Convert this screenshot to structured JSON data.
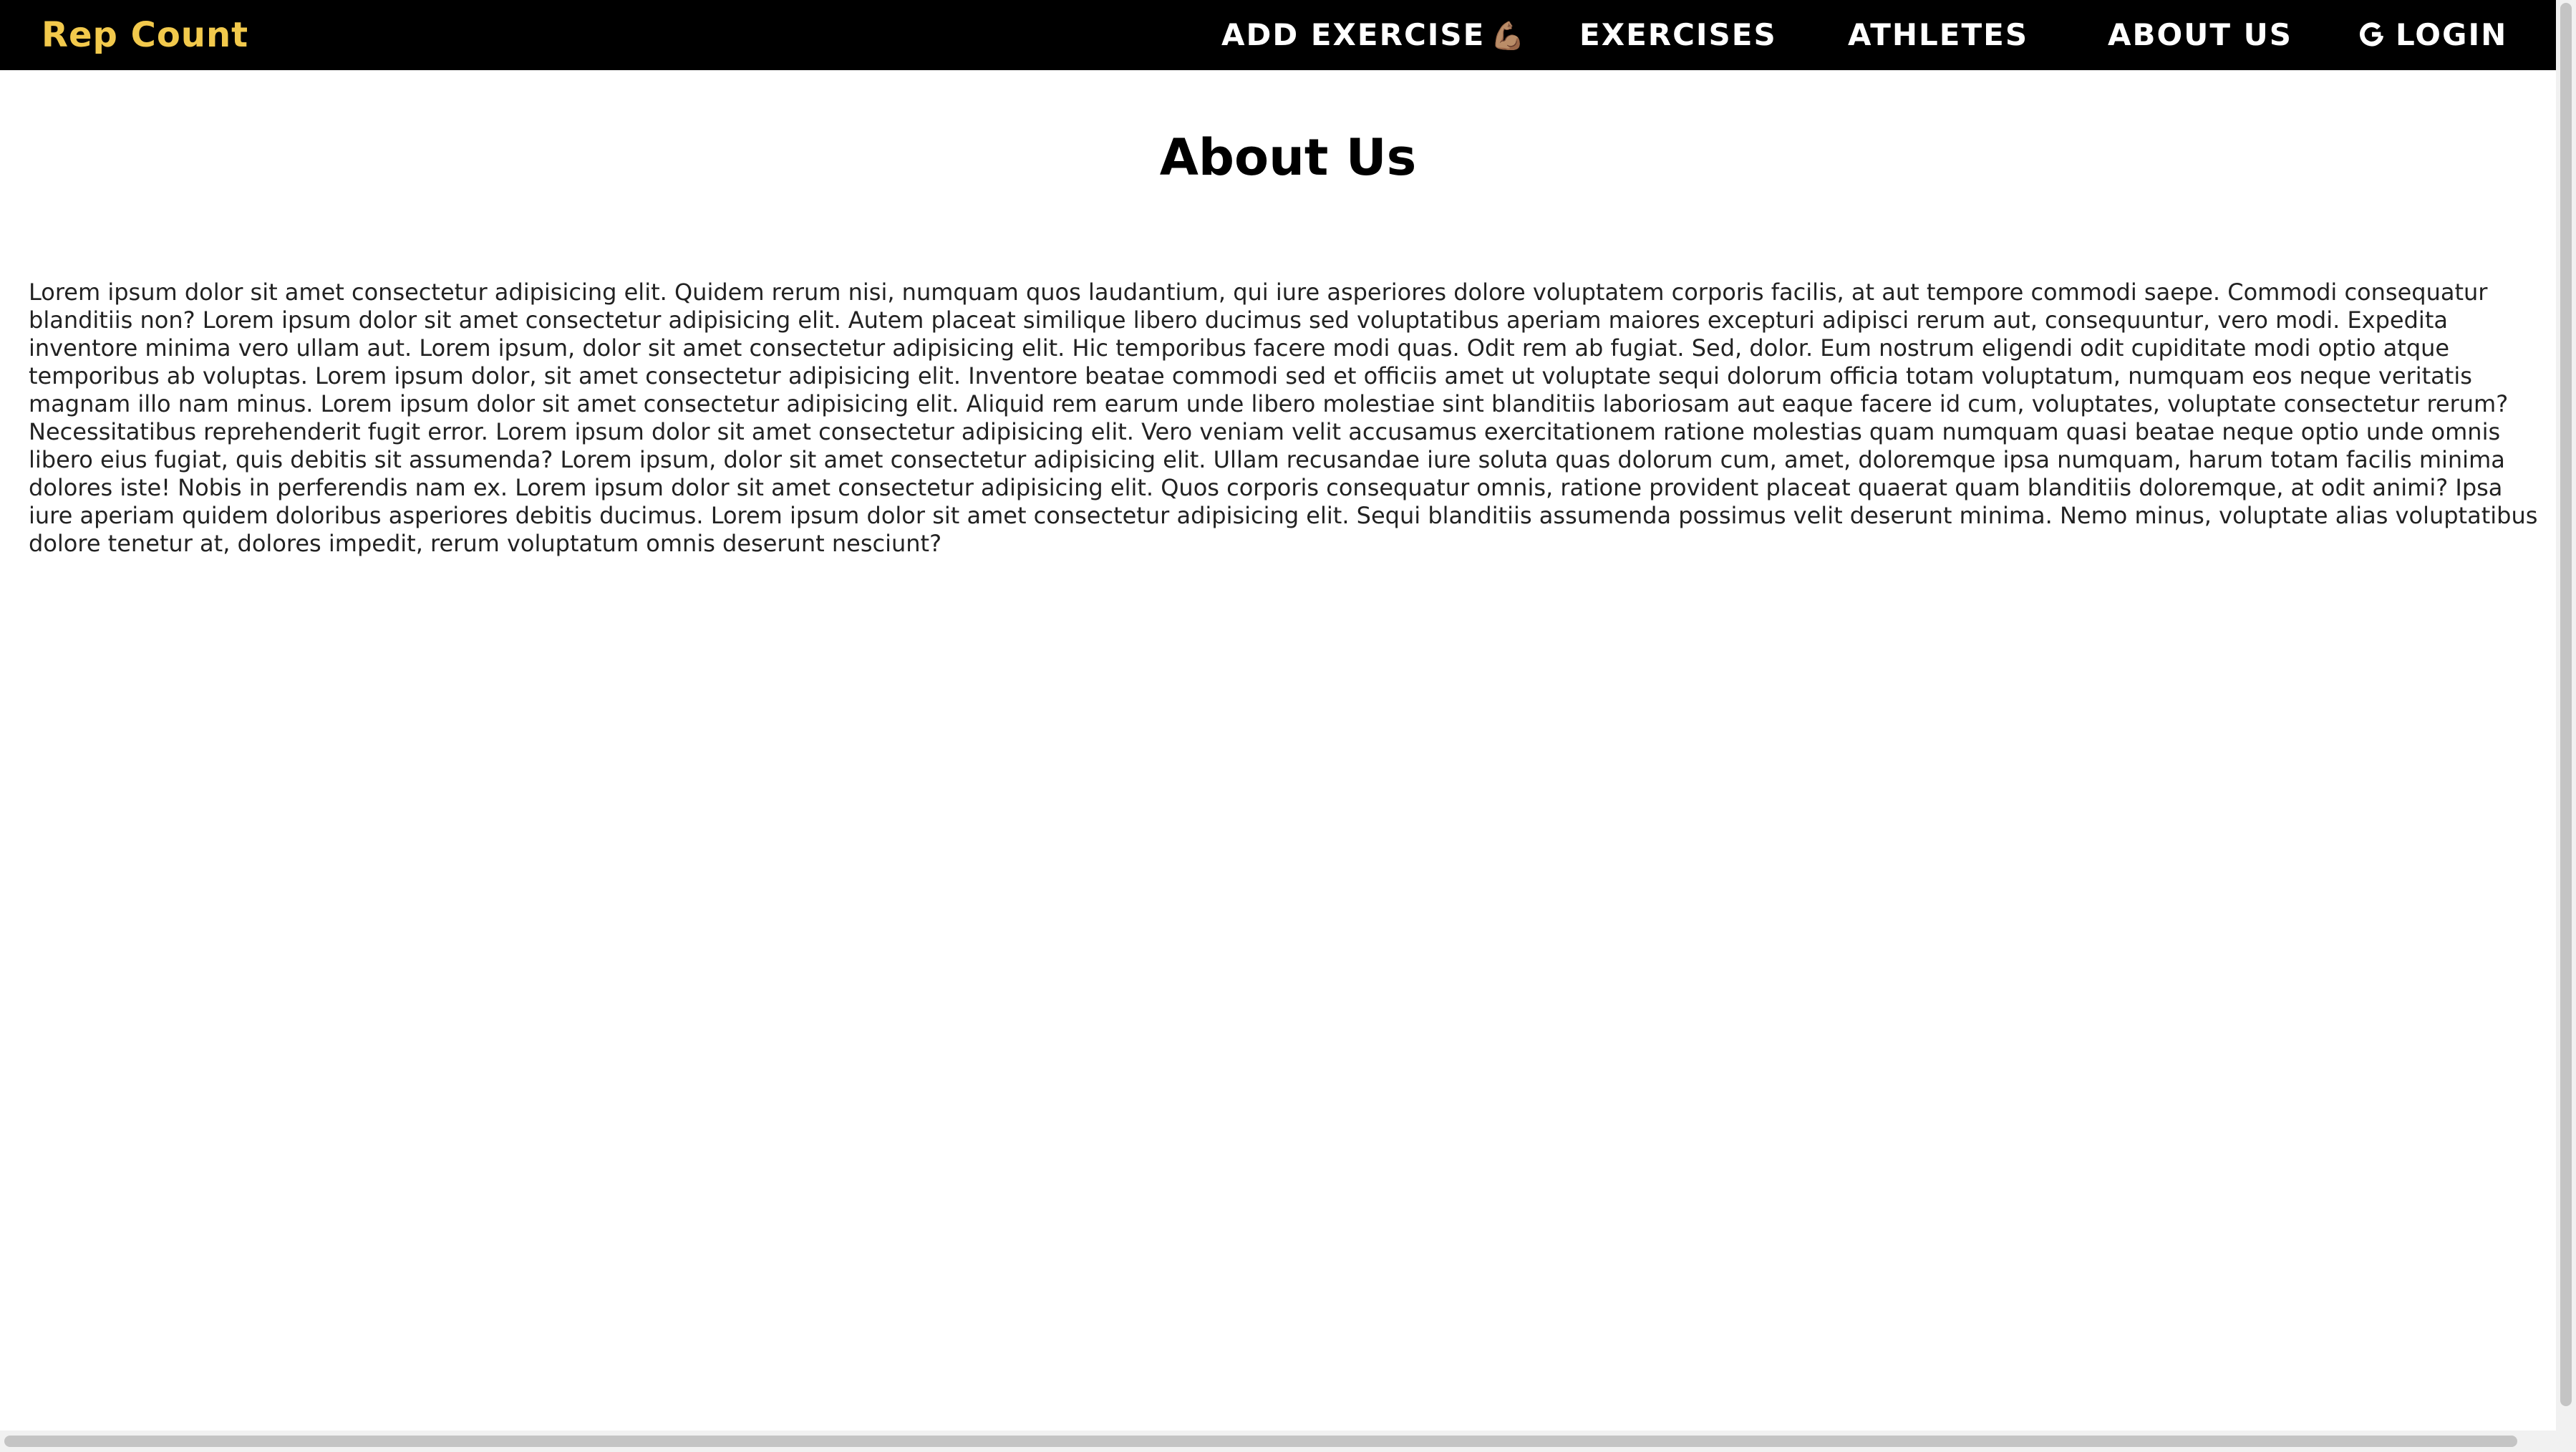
{
  "app": {
    "brand": "Rep Count"
  },
  "nav": {
    "add_exercise": "ADD EXERCISE",
    "add_exercise_emoji": "💪🏽",
    "exercises": "EXERCISES",
    "athletes": "ATHLETES",
    "about_us": "ABOUT US",
    "login": "LOGIN",
    "login_icon": "google-g-icon"
  },
  "main": {
    "title": "About Us",
    "body": "Lorem ipsum dolor sit amet consectetur adipisicing elit. Quidem rerum nisi, numquam quos laudantium, qui iure asperiores dolore voluptatem corporis facilis, at aut tempore commodi saepe. Commodi consequatur blanditiis non? Lorem ipsum dolor sit amet consectetur adipisicing elit. Autem placeat similique libero ducimus sed voluptatibus aperiam maiores excepturi adipisci rerum aut, consequuntur, vero modi. Expedita inventore minima vero ullam aut. Lorem ipsum, dolor sit amet consectetur adipisicing elit. Hic temporibus facere modi quas. Odit rem ab fugiat. Sed, dolor. Eum nostrum eligendi odit cupiditate modi optio atque temporibus ab voluptas. Lorem ipsum dolor, sit amet consectetur adipisicing elit. Inventore beatae commodi sed et officiis amet ut voluptate sequi dolorum officia totam voluptatum, numquam eos neque veritatis magnam illo nam minus. Lorem ipsum dolor sit amet consectetur adipisicing elit. Aliquid rem earum unde libero molestiae sint blanditiis laboriosam aut eaque facere id cum, voluptates, voluptate consectetur rerum? Necessitatibus reprehenderit fugit error. Lorem ipsum dolor sit amet consectetur adipisicing elit. Vero veniam velit accusamus exercitationem ratione molestias quam numquam quasi beatae neque optio unde omnis libero eius fugiat, quis debitis sit assumenda? Lorem ipsum, dolor sit amet consectetur adipisicing elit. Ullam recusandae iure soluta quas dolorum cum, amet, doloremque ipsa numquam, harum totam facilis minima dolores iste! Nobis in perferendis nam ex. Lorem ipsum dolor sit amet consectetur adipisicing elit. Quos corporis consequatur omnis, ratione provident placeat quaerat quam blanditiis doloremque, at odit animi? Ipsa iure aperiam quidem doloribus asperiores debitis ducimus. Lorem ipsum dolor sit amet consectetur adipisicing elit. Sequi blanditiis assumenda possimus velit deserunt minima. Nemo minus, voluptate alias voluptatibus dolore tenetur at, dolores impedit, rerum voluptatum omnis deserunt nesciunt?"
  },
  "colors": {
    "navbar_bg": "#000000",
    "brand": "#f2c94c",
    "nav_text": "#ffffff",
    "page_bg": "#ffffff",
    "body_text": "#222222"
  }
}
